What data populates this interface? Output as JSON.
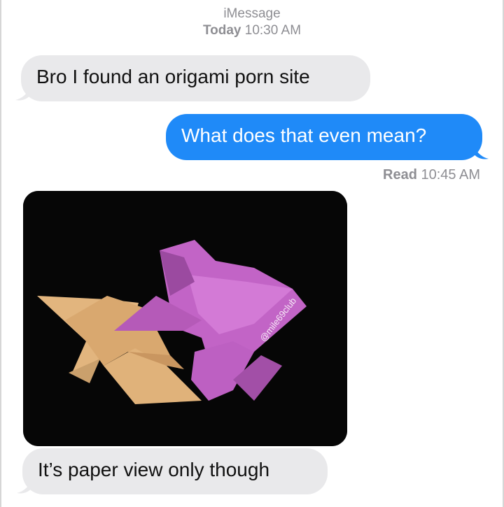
{
  "header": {
    "service": "iMessage",
    "day": "Today",
    "time": "10:30 AM"
  },
  "messages": [
    {
      "direction": "incoming",
      "text": "Bro I found an origami porn site"
    },
    {
      "direction": "outgoing",
      "text": "What does that even mean?"
    },
    {
      "direction": "incoming",
      "type": "image",
      "watermark": "@mile69club"
    },
    {
      "direction": "incoming",
      "text": "It’s paper view only though"
    }
  ],
  "receipt": {
    "label": "Read",
    "time": "10:45 AM"
  },
  "colors": {
    "incoming_bubble": "#e9e9eb",
    "outgoing_bubble": "#1f8af8",
    "meta_text": "#8e8e93"
  }
}
